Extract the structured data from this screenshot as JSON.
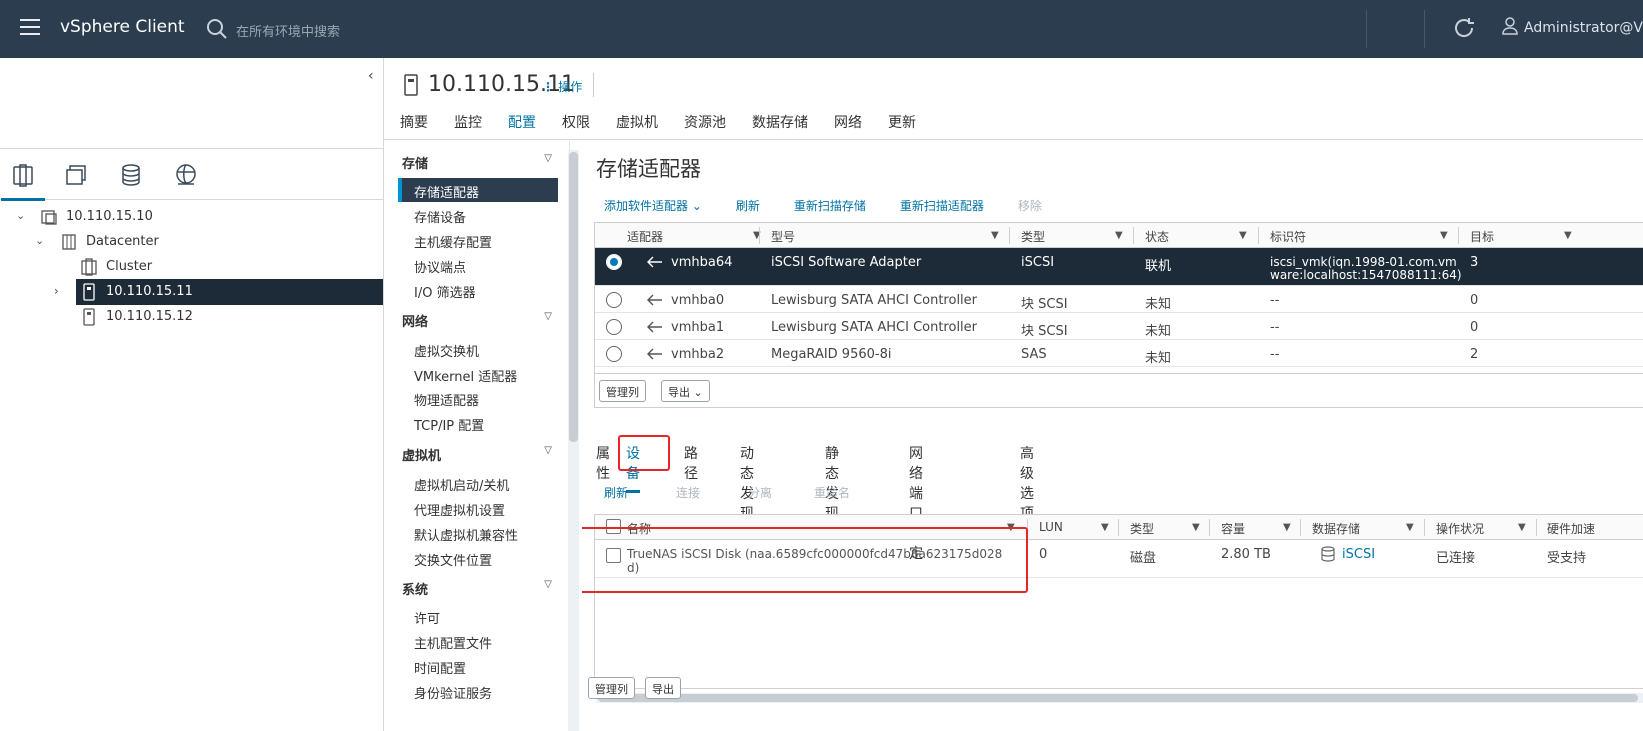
{
  "header": {
    "brand": "vSphere Client",
    "search_placeholder": "在所有环境中搜索",
    "user": "Administrator@VS"
  },
  "inventory": {
    "tree": [
      {
        "label": "10.110.15.10",
        "icon": "vcenter-icon"
      },
      {
        "label": "Datacenter",
        "icon": "datacenter-icon"
      },
      {
        "label": "Cluster",
        "icon": "cluster-icon"
      },
      {
        "label": "10.110.15.11",
        "icon": "host-icon",
        "selected": true
      },
      {
        "label": "10.110.15.12",
        "icon": "host-icon"
      }
    ]
  },
  "object": {
    "title": "10.110.15.11",
    "actions": "操作",
    "tabs": [
      "摘要",
      "监控",
      "配置",
      "权限",
      "虚拟机",
      "资源池",
      "数据存储",
      "网络",
      "更新"
    ],
    "active_tab": "配置"
  },
  "config_nav": {
    "groups": [
      {
        "label": "存储",
        "items": [
          "存储适配器",
          "存储设备",
          "主机缓存配置",
          "协议端点",
          "I/O 筛选器"
        ]
      },
      {
        "label": "网络",
        "items": [
          "虚拟交换机",
          "VMkernel 适配器",
          "物理适配器",
          "TCP/IP 配置"
        ]
      },
      {
        "label": "虚拟机",
        "items": [
          "虚拟机启动/关机",
          "代理虚拟机设置",
          "默认虚拟机兼容性",
          "交换文件位置"
        ]
      },
      {
        "label": "系统",
        "items": [
          "许可",
          "主机配置文件",
          "时间配置",
          "身份验证服务"
        ]
      }
    ],
    "active_item": "存储适配器"
  },
  "adapters": {
    "title": "存储适配器",
    "toolbar": {
      "add": "添加软件适配器 ⌄",
      "refresh": "刷新",
      "rescan_storage": "重新扫描存储",
      "rescan_adapter": "重新扫描适配器",
      "remove": "移除"
    },
    "columns": [
      "适配器",
      "型号",
      "类型",
      "状态",
      "标识符",
      "目标"
    ],
    "rows": [
      {
        "adapter": "vmhba64",
        "model": "iSCSI Software Adapter",
        "type": "iSCSI",
        "status": "联机",
        "id1": "iscsi_vmk(iqn.1998-01.com.vm",
        "id2": "ware:localhost:1547088111:64)",
        "target": "3",
        "selected": true
      },
      {
        "adapter": "vmhba0",
        "model": "Lewisburg SATA AHCI Controller",
        "type": "块 SCSI",
        "status": "未知",
        "id1": "--",
        "id2": "",
        "target": "0"
      },
      {
        "adapter": "vmhba1",
        "model": "Lewisburg SATA AHCI Controller",
        "type": "块 SCSI",
        "status": "未知",
        "id1": "--",
        "id2": "",
        "target": "0"
      },
      {
        "adapter": "vmhba2",
        "model": "MegaRAID 9560-8i",
        "type": "SAS",
        "status": "未知",
        "id1": "--",
        "id2": "",
        "target": "2"
      }
    ],
    "manage_columns": "管理列",
    "export": "导出 ⌄"
  },
  "details": {
    "tabs": [
      "属性",
      "设备",
      "路径",
      "动态发现",
      "静态发现",
      "网络端口绑定",
      "高级选项"
    ],
    "active_tab": "设备",
    "toolbar": {
      "refresh": "刷新",
      "attach": "连接",
      "detach": "分离",
      "rename": "重命名"
    },
    "columns": [
      "名称",
      "LUN",
      "类型",
      "容量",
      "数据存储",
      "操作状况",
      "硬件加速"
    ],
    "rows": [
      {
        "name1": "TrueNAS iSCSI Disk (naa.6589cfc000000fcd47b8a623175d028",
        "name2": "d)",
        "lun": "0",
        "type": "磁盘",
        "capacity": "2.80 TB",
        "datastore": "iSCSI",
        "op_state": "已连接",
        "hw_accel": "受支持"
      }
    ],
    "manage_columns": "管理列",
    "export": "导出"
  },
  "colors": {
    "topbar": "#2b3d4f",
    "accent": "#0072a3",
    "selected_row": "#1d2b38",
    "highlight_box": "#e5252a"
  }
}
